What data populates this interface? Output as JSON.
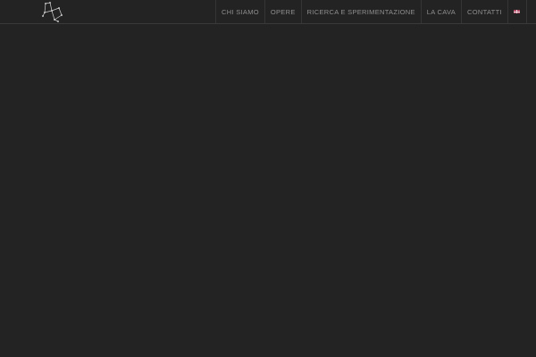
{
  "header": {
    "logo_icon": "constellation-logo-icon",
    "nav": {
      "items": [
        {
          "label": "CHI SIAMO"
        },
        {
          "label": "OPERE"
        },
        {
          "label": "RICERCA E SPERIMENTAZIONE"
        },
        {
          "label": "LA CAVA"
        },
        {
          "label": "CONTATTI"
        }
      ],
      "language_icon": "uk-flag-icon"
    }
  },
  "colors": {
    "background": "#232323",
    "nav_text": "#8f8f8f",
    "divider": "#353535"
  }
}
